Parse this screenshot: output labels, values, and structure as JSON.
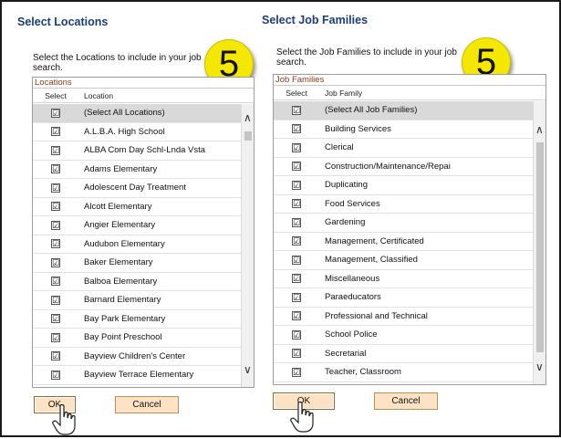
{
  "left": {
    "title": "Select Locations",
    "instructions_line1": "Select the Locations to include in your job",
    "instructions_line2": "search.",
    "badge": "5",
    "grid_label": "Locations",
    "col_select": "Select",
    "col_name": "Location",
    "items": [
      "(Select All Locations)",
      "A.L.B.A. High School",
      "ALBA Com Day Schl-Lnda Vsta",
      "Adams Elementary",
      "Adolescent Day Treatment",
      "Alcott Elementary",
      "Angier Elementary",
      "Audubon Elementary",
      "Baker Elementary",
      "Balboa Elementary",
      "Barnard Elementary",
      "Bay Park Elementary",
      "Bay Point Preschool",
      "Bayview Children's Center",
      "Bayview Terrace Elementary"
    ],
    "ok_label": "OK",
    "cancel_label": "Cancel"
  },
  "right": {
    "title": "Select Job Families",
    "instructions_line1": "Select the Job Families to include in your job",
    "instructions_line2": "search.",
    "badge": "5",
    "grid_label": "Job Families",
    "col_select": "Select",
    "col_name": "Job Family",
    "items": [
      "(Select All Job Families)",
      "Building Services",
      "Clerical",
      "Construction/Maintenance/Repai",
      "Duplicating",
      "Food Services",
      "Gardening",
      "Management, Certificated",
      "Management, Classified",
      "Miscellaneous",
      "Paraeducators",
      "Professional and Technical",
      "School Police",
      "Secretarial",
      "Teacher, Classroom"
    ],
    "ok_label": "OK",
    "cancel_label": "Cancel"
  },
  "checkmark": "☑",
  "colors": {
    "title": "#1e3c78",
    "grid_label": "#8b3a1a",
    "badge": "#f5e800",
    "button": "#fde3c4",
    "selected_row": "#d9d9d9"
  }
}
